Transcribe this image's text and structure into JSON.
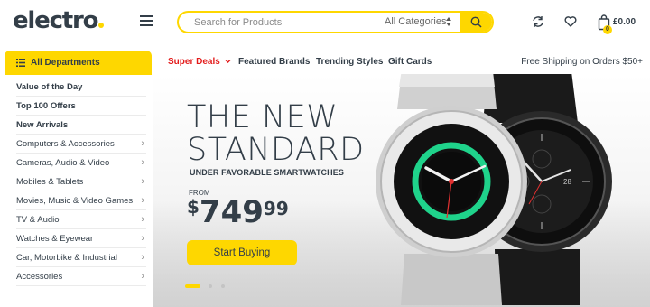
{
  "header": {
    "logo": "electro",
    "search_placeholder": "Search for Products",
    "categories_label": "All Categories",
    "cart_count": "0",
    "cart_total": "£0.00"
  },
  "nav": {
    "departments_label": "All Departments",
    "links": [
      "Super Deals",
      "Featured Brands",
      "Trending Styles",
      "Gift Cards"
    ],
    "shipping": "Free Shipping on Orders $50+"
  },
  "sidebar": {
    "items": [
      {
        "label": "Value of the Day"
      },
      {
        "label": "Top 100 Offers"
      },
      {
        "label": "New Arrivals"
      },
      {
        "label": "Computers & Accessories"
      },
      {
        "label": "Cameras, Audio & Video"
      },
      {
        "label": "Mobiles & Tablets"
      },
      {
        "label": "Movies, Music & Video Games"
      },
      {
        "label": "TV & Audio"
      },
      {
        "label": "Watches & Eyewear"
      },
      {
        "label": "Car, Motorbike & Industrial"
      },
      {
        "label": "Accessories"
      }
    ]
  },
  "hero": {
    "title_line1": "THE NEW",
    "title_line2": "STANDARD",
    "subtitle": "UNDER FAVORABLE SMARTWATCHES",
    "from_label": "FROM",
    "price_currency": "$",
    "price_whole": "749",
    "price_cents": "99",
    "button": "Start Buying",
    "watch_face_label": "28",
    "slides_total": 3,
    "active_slide": 1
  },
  "colors": {
    "accent": "#fed700",
    "text": "#333e48",
    "deal_red": "#e31d1d",
    "watch_ring": "#1fd38b"
  }
}
